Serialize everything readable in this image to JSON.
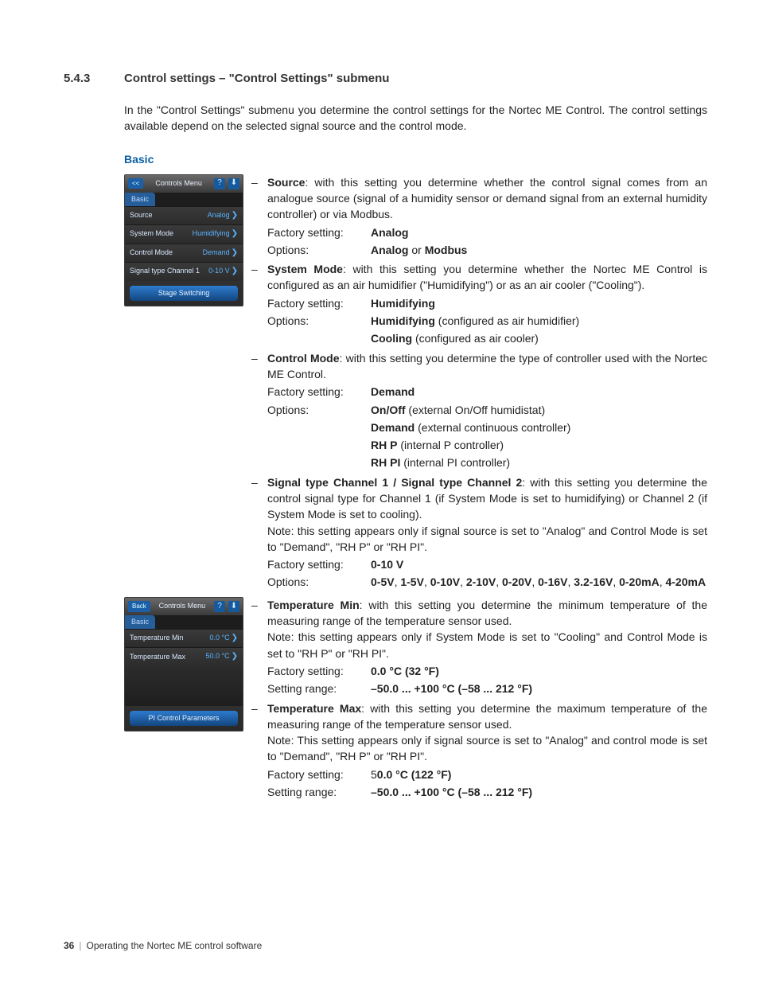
{
  "heading": {
    "number": "5.4.3",
    "title": "Control settings – \"Control Settings\" submenu"
  },
  "intro": "In the \"Control Settings\" submenu you determine the control settings for the Nortec ME Control. The control settings available depend on the selected signal source and the control mode.",
  "basic_label": "Basic",
  "mock1": {
    "back": "<<",
    "title": "Controls Menu",
    "tab": "Basic",
    "rows": [
      {
        "k": "Source",
        "v": "Analog"
      },
      {
        "k": "System Mode",
        "v": "Humidifying"
      },
      {
        "k": "Control Mode",
        "v": "Demand"
      },
      {
        "k": "Signal type Channel 1",
        "v": "0-10 V"
      }
    ],
    "bottom": "Stage Switching"
  },
  "mock2": {
    "back": "Back",
    "title": "Controls Menu",
    "tab": "Basic",
    "rows": [
      {
        "k": "Temperature Min",
        "v": "0.0 °C"
      },
      {
        "k": "Temperature Max",
        "v": "50.0 °C"
      }
    ],
    "bottom": "PI Control Parameters"
  },
  "labels": {
    "factory": "Factory setting:",
    "options": "Options:",
    "range": "Setting range:"
  },
  "items": {
    "source": {
      "name": "Source",
      "text": ": with this setting you determine whether the control signal comes from an analogue source (signal of a humidity sensor or demand signal from an external humidity controller) or via Modbus.",
      "factory": "Analog",
      "options_html": "<b>Analog</b> or <b>Modbus</b>"
    },
    "system_mode": {
      "name": "System Mode",
      "text": ": with this setting you determine whether the Nortec ME Control is configured as an air humidifier (\"Humidifying\") or as an air cooler (\"Cooling\").",
      "factory": "Humidifying",
      "opt1_b": "Humidifying",
      "opt1_t": " (configured as air humidifier)",
      "opt2_b": "Cooling",
      "opt2_t": " (configured as air cooler)"
    },
    "control_mode": {
      "name": "Control Mode",
      "text": ": with this setting you determine the type of controller used with the Nortec ME Control.",
      "factory": "Demand",
      "o1b": "On/Off",
      "o1t": " (external On/Off humidistat)",
      "o2b": "Demand",
      "o2t": " (external continuous controller)",
      "o3b": "RH P",
      "o3t": " (internal P controller)",
      "o4b": "RH PI",
      "o4t": " (internal PI controller)"
    },
    "signal": {
      "name": "Signal type Channel 1 / Signal type Channel 2",
      "text": ": with this setting you determine the control signal type for Channel 1 (if System Mode is set to humidifying) or Channel 2 (if System Mode is set to cooling).",
      "note": "Note: this setting appears only if signal source is set to \"Analog\" and Control Mode is set to \"Demand\", \"RH P\" or \"RH PI\".",
      "factory": "0-10 V",
      "options_html": "<b>0-5V</b>, <b>1-5V</b>, <b>0-10V</b>, <b>2-10V</b>, <b>0-20V</b>, <b>0-16V</b>, <b>3.2-16V</b>, <b>0-20mA</b>, <b>4-20mA</b>"
    },
    "tmin": {
      "name": "Temperature Min",
      "text": ": with this setting you determine the minimum temperature of the measuring range of the temperature sensor used.",
      "note": "Note: this setting appears only if System Mode is set to \"Cooling\" and Control Mode is set to \"RH P\" or \"RH PI\".",
      "factory": "0.0 °C (32 °F)",
      "range": "–50.0 ... +100 °C (–58 ... 212 °F)"
    },
    "tmax": {
      "name": "Temperature Max",
      "text": ": with this setting you determine the maximum temperature of the measuring range of the temperature sensor used.",
      "note": "Note: This setting appears only if signal source is set to \"Analog\" and control mode is set to \"Demand\", \"RH P\" or \"RH PI\".",
      "factory_pre": "5",
      "factory": "0.0 °C (122 °F)",
      "range": "–50.0 ... +100 °C (–58 ... 212 °F)"
    }
  },
  "footer": {
    "page": "36",
    "text": "Operating the Nortec ME control software"
  }
}
